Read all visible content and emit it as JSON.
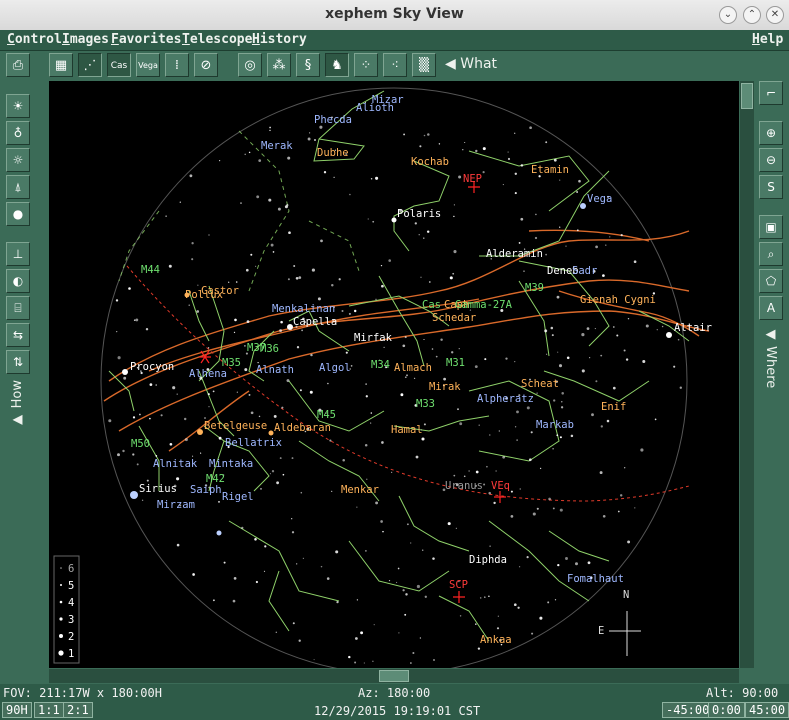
{
  "window": {
    "title": "xephem Sky View"
  },
  "menubar": {
    "items": [
      {
        "ul": "C",
        "rest": "ontrol"
      },
      {
        "ul": "I",
        "rest": "mages"
      },
      {
        "ul": "F",
        "rest": "avorites"
      },
      {
        "ul": "T",
        "rest": "elescope"
      },
      {
        "ul": "H",
        "rest": "istory"
      }
    ],
    "help": {
      "ul": "H",
      "rest": "elp"
    }
  },
  "toolbar": {
    "buttons": [
      {
        "name": "camera-icon",
        "glyph": "⎙"
      },
      {
        "name": "grid-icon",
        "glyph": "▦"
      },
      {
        "name": "constellation-figure-icon",
        "glyph": "⋰"
      },
      {
        "name": "constellation-names-icon",
        "glyph": "Cas"
      },
      {
        "name": "star-names-icon",
        "glyph": "Vega"
      },
      {
        "name": "magnitude-icon",
        "glyph": "⁞"
      },
      {
        "name": "eclipse-icon",
        "glyph": "⊘"
      },
      {
        "name": "target-icon",
        "glyph": "◎"
      },
      {
        "name": "milkyway-dots-icon",
        "glyph": "⁂"
      },
      {
        "name": "galaxy-icon",
        "glyph": "§"
      },
      {
        "name": "horse-head-icon",
        "glyph": "♞"
      },
      {
        "name": "cluster-icon",
        "glyph": "⁘"
      },
      {
        "name": "scatter-icon",
        "glyph": "⁖"
      },
      {
        "name": "field-stars-icon",
        "glyph": "▒"
      }
    ],
    "what_label": "What"
  },
  "left_panel": {
    "buttons": [
      {
        "name": "bright-bulb-icon",
        "glyph": "☀"
      },
      {
        "name": "bulb-icon",
        "glyph": "♁"
      },
      {
        "name": "bulbs-icon",
        "glyph": "☼"
      },
      {
        "name": "telescope-icon",
        "glyph": "⍋"
      },
      {
        "name": "sphere-icon",
        "glyph": "●"
      },
      {
        "name": "axes-icon",
        "glyph": "⊥"
      },
      {
        "name": "half-moon-icon",
        "glyph": "◐"
      },
      {
        "name": "cylinder-icon",
        "glyph": "⌸"
      },
      {
        "name": "arrows-lr-icon",
        "glyph": "⇆"
      },
      {
        "name": "arrows-ud-icon",
        "glyph": "⇅"
      }
    ],
    "how_label": "How"
  },
  "right_panel": {
    "buttons": [
      {
        "name": "sky-corner-icon",
        "glyph": "⌐"
      },
      {
        "name": "zoom-in-icon",
        "glyph": "⊕"
      },
      {
        "name": "zoom-out-icon",
        "glyph": "⊖"
      },
      {
        "name": "zoom-s-icon",
        "glyph": "S"
      },
      {
        "name": "sky-patch-icon",
        "glyph": "▣"
      },
      {
        "name": "magnify-icon",
        "glyph": "⌕"
      },
      {
        "name": "shape-icon",
        "glyph": "⬠"
      },
      {
        "name": "a-marker-icon",
        "glyph": "A"
      }
    ],
    "where_label": "Where"
  },
  "magnitude_legend": [
    "6",
    "5",
    "4",
    "3",
    "2",
    "1"
  ],
  "sky_labels": {
    "white": [
      {
        "t": "Polaris"
      },
      {
        "t": "Alderamin"
      },
      {
        "t": "Deneb"
      },
      {
        "t": "Capella"
      },
      {
        "t": "Mirfak"
      },
      {
        "t": "Diphda"
      },
      {
        "t": "Sirius"
      },
      {
        "t": "Altair"
      },
      {
        "t": "Procyon"
      }
    ],
    "blue": [
      {
        "t": "Mizar"
      },
      {
        "t": "Alioth"
      },
      {
        "t": "Phecda"
      },
      {
        "t": "Merak"
      },
      {
        "t": "Vega"
      },
      {
        "t": "Menkalinan"
      },
      {
        "t": "Alhena"
      },
      {
        "t": "Alnath"
      },
      {
        "t": "Algol"
      },
      {
        "t": "Alpheratz"
      },
      {
        "t": "Markab"
      },
      {
        "t": "Bellatrix"
      },
      {
        "t": "Alnitak"
      },
      {
        "t": "Mintaka"
      },
      {
        "t": "Saiph"
      },
      {
        "t": "Rigel"
      },
      {
        "t": "Mirzam"
      },
      {
        "t": "Fomalhaut"
      },
      {
        "t": "Sadr"
      }
    ],
    "orange": [
      {
        "t": "Dubhe"
      },
      {
        "t": "Kochab"
      },
      {
        "t": "Etamin"
      },
      {
        "t": "Gienah Cygni"
      },
      {
        "t": "Pollux"
      },
      {
        "t": "Castor"
      },
      {
        "t": "Caph"
      },
      {
        "t": "Schedar"
      },
      {
        "t": "Almach"
      },
      {
        "t": "Mirak"
      },
      {
        "t": "Scheat"
      },
      {
        "t": "Enif"
      },
      {
        "t": "Hamal"
      },
      {
        "t": "Betelgeuse"
      },
      {
        "t": "Aldebaran"
      },
      {
        "t": "Menkar"
      },
      {
        "t": "Ankaa"
      }
    ],
    "green": [
      {
        "t": "M44"
      },
      {
        "t": "M35"
      },
      {
        "t": "M37"
      },
      {
        "t": "M36"
      },
      {
        "t": "M34"
      },
      {
        "t": "M31"
      },
      {
        "t": "M33"
      },
      {
        "t": "M45"
      },
      {
        "t": "M50"
      },
      {
        "t": "M42"
      },
      {
        "t": "M39"
      },
      {
        "t": "Gamma-27A"
      },
      {
        "t": "Cas"
      }
    ],
    "red": [
      {
        "t": "NEP"
      },
      {
        "t": "SCP"
      },
      {
        "t": "VEq"
      }
    ],
    "grey": [
      {
        "t": "Uranus"
      }
    ],
    "compass": {
      "n": "N",
      "e": "E"
    }
  },
  "status": {
    "fov": "FOV: 211:17W x 180:00H",
    "az": "Az: 180:00",
    "alt": "Alt:  90:00",
    "b90": "90H",
    "b11": "1:1",
    "b21": "2:1",
    "datetime": "12/29/2015 19:19:01 CST",
    "rb1": "-45:00",
    "rb2": "0:00",
    "rb3": "45:00"
  },
  "colors": {
    "bg": "#3b6b57",
    "sky": "#000000",
    "constellation": "#8fd16a",
    "milkyway": "#d9692a",
    "ecliptic": "#e03a2a",
    "star_white": "#ffffff",
    "star_blue": "#9fb8ff",
    "label_orange": "#ffb35a",
    "label_green": "#6fe06f",
    "marker_red": "#ff2222"
  }
}
